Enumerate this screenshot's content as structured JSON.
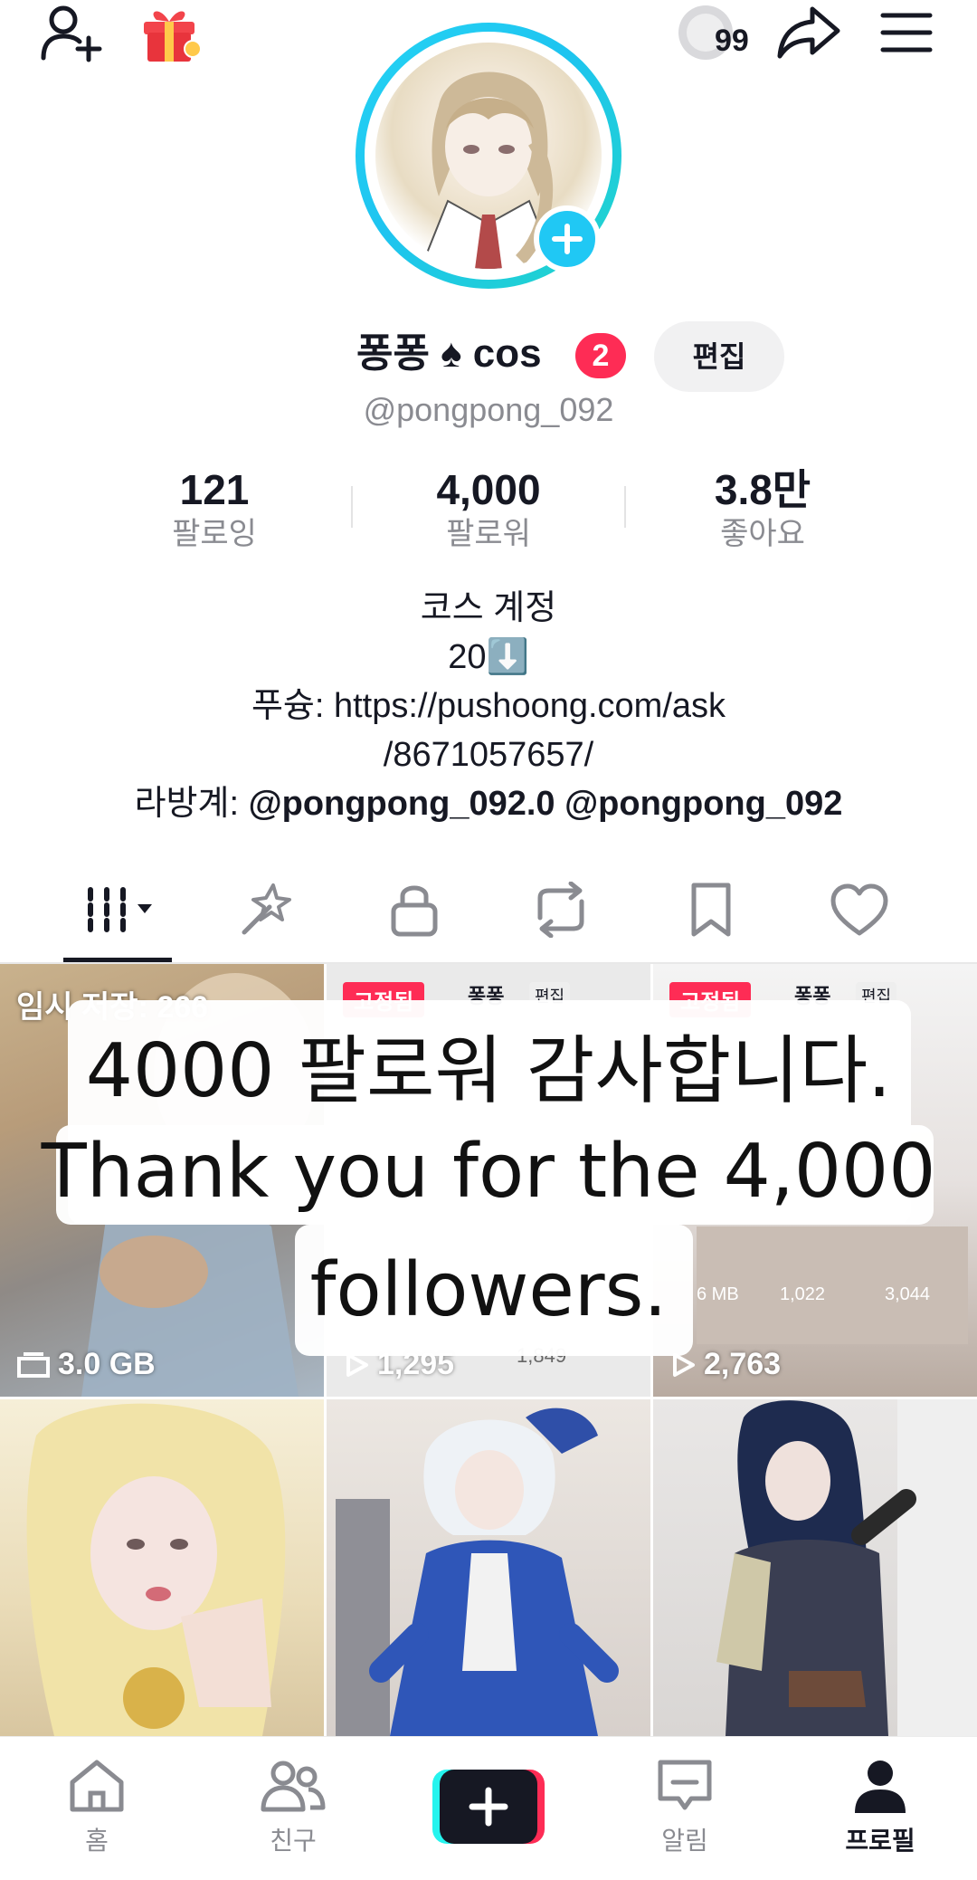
{
  "top_bar": {
    "add_friend_icon": "person-plus-icon",
    "gift_icon": "gift-icon",
    "coin_count": "99",
    "share_icon": "share-arrow-icon",
    "menu_icon": "hamburger-menu-icon"
  },
  "profile": {
    "name": "퐁퐁 ♠ cos",
    "notification_count": "2",
    "edit_label": "편집",
    "handle": "@pongpong_092",
    "stats": [
      {
        "value": "121",
        "label": "팔로잉"
      },
      {
        "value": "4,000",
        "label": "팔로워"
      },
      {
        "value": "3.8만",
        "label": "좋아요"
      }
    ],
    "bio_lines": [
      "코스 계정",
      "20⬇️",
      "푸슝: https://pushoong.com/ask",
      "/8671057657/"
    ],
    "alt_prefix": "라방계: ",
    "alt_accounts": "@pongpong_092.0 @pongpong_092"
  },
  "tabs": [
    {
      "icon": "grid-dropdown-icon"
    },
    {
      "icon": "sparkle-icon"
    },
    {
      "icon": "lock-icon"
    },
    {
      "icon": "repost-icon"
    },
    {
      "icon": "bookmark-icon"
    },
    {
      "icon": "heart-icon"
    }
  ],
  "grid": {
    "drafts_label": "임시 저장: 266",
    "drafts_size": "3.0 GB",
    "pinned_label": "고정됨",
    "pinned_user": "퐁퐁",
    "pinned_edit": "편집",
    "tile2_views": "1,295",
    "tile2_small_views": "1,849",
    "tile3_views": "2,763",
    "tile3_small_a": "1,022",
    "tile3_small_b": "3,044",
    "tile3_small_c": "6 MB"
  },
  "overlay": {
    "line1": "4000 팔로워 감사합니다.",
    "line2": "Thank you for the 4,000",
    "line3": "followers."
  },
  "nav": {
    "home": "홈",
    "friends": "친구",
    "inbox": "알림",
    "profile": "프로필"
  },
  "colors": {
    "accent_red": "#fe2c55",
    "accent_cyan": "#25d3f4",
    "text_primary": "#161823",
    "text_secondary": "#8a8b91"
  }
}
